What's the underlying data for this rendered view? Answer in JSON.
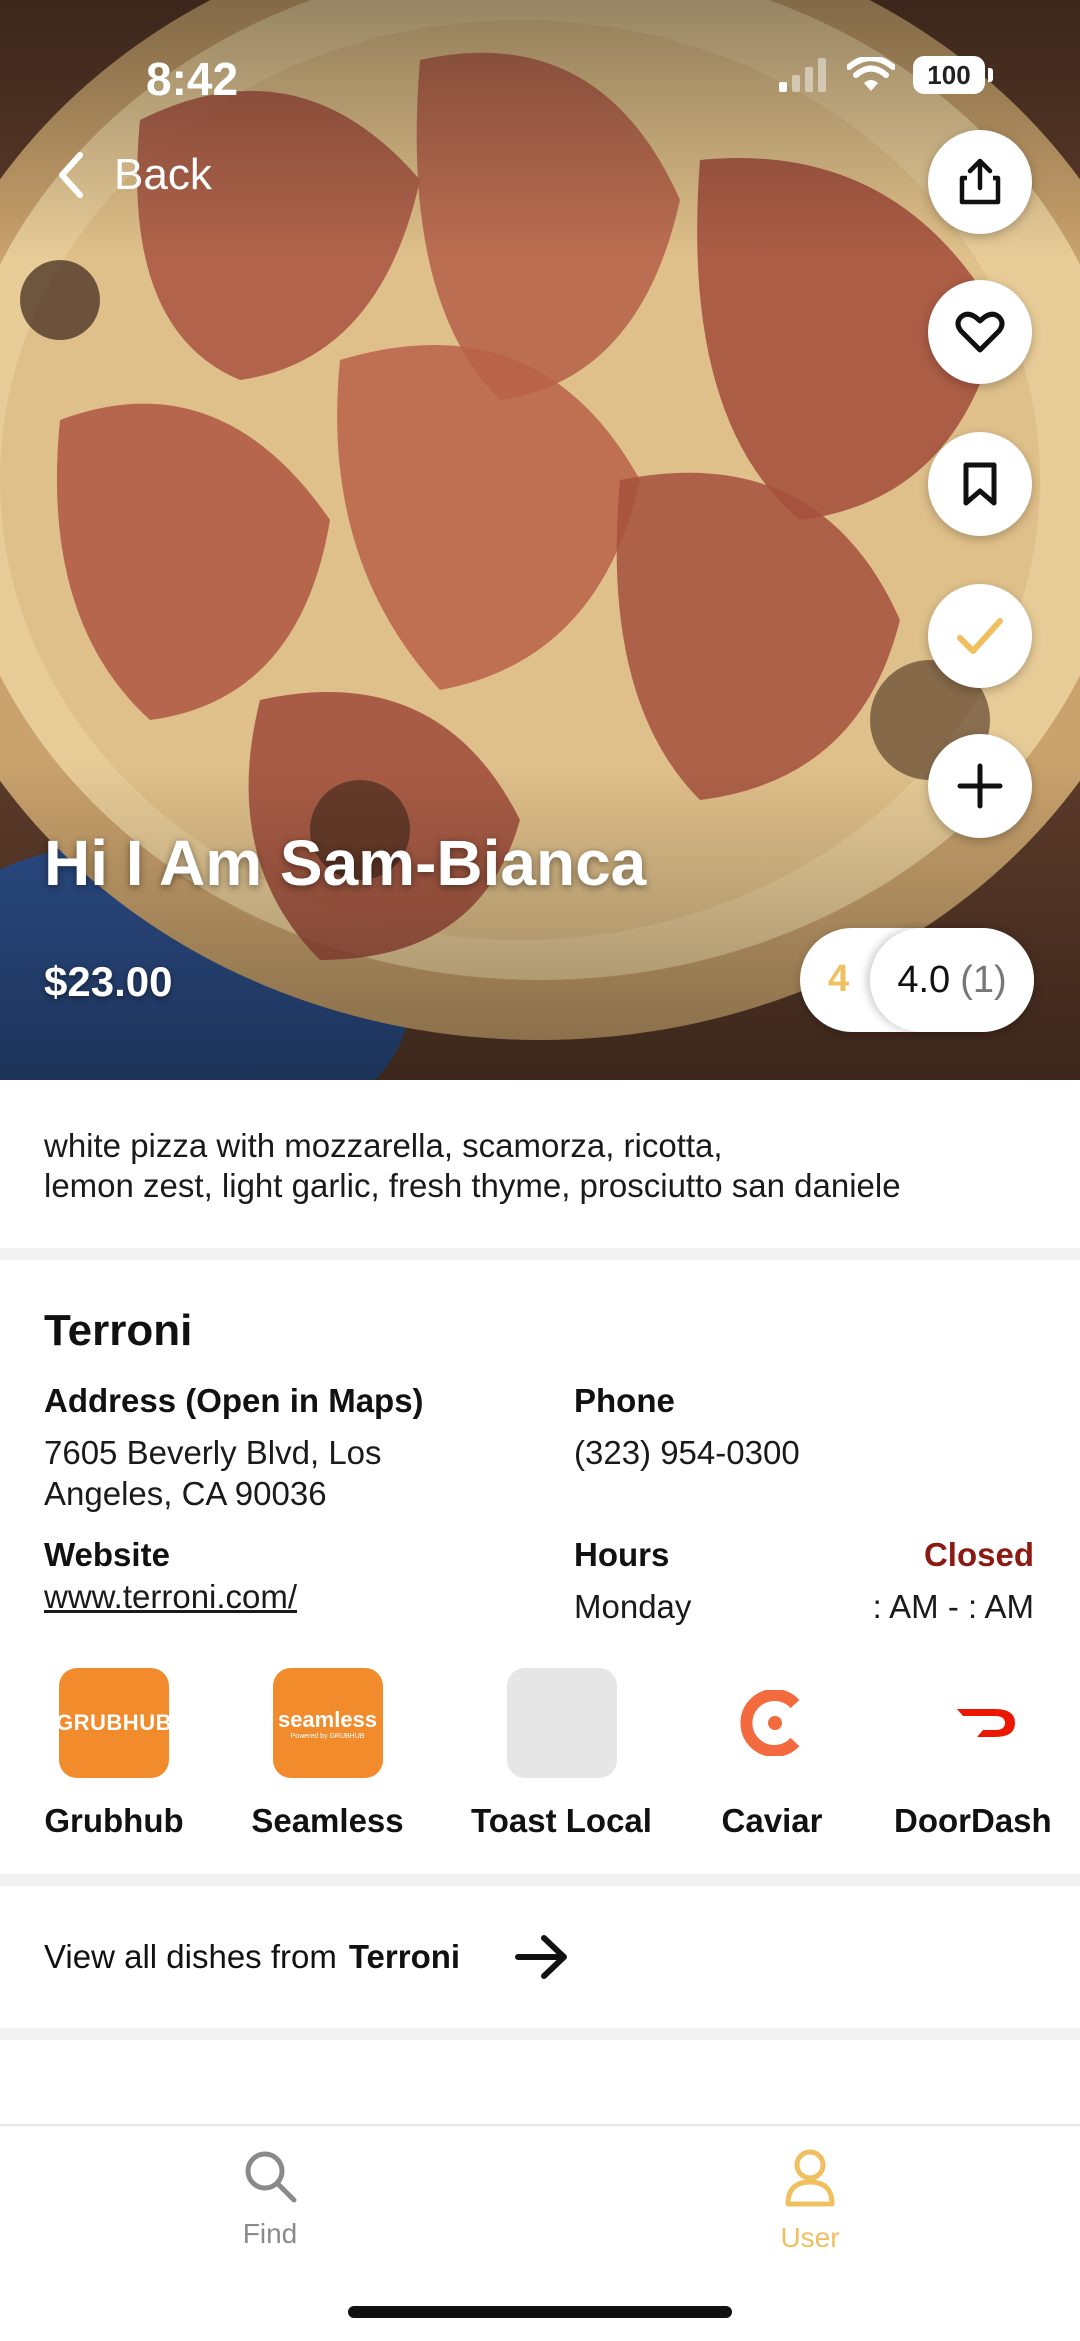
{
  "status_bar": {
    "time": "8:42",
    "battery": "100"
  },
  "nav": {
    "back_label": "Back"
  },
  "actions": [
    {
      "icon": "share-icon"
    },
    {
      "icon": "heart-icon"
    },
    {
      "icon": "bookmark-icon"
    },
    {
      "icon": "checkmark-icon"
    },
    {
      "icon": "plus-icon"
    }
  ],
  "dish": {
    "title": "Hi I Am Sam-Bianca",
    "price": "$23.00",
    "my_rating": "4",
    "average_rating": "4.0",
    "rating_count": "(1)",
    "description_line1": "white pizza with mozzarella, scamorza, ricotta,",
    "description_line2": "lemon zest, light garlic, fresh thyme, prosciutto san daniele"
  },
  "restaurant": {
    "name": "Terroni",
    "address_label": "Address (Open in Maps)",
    "address_line1": "7605 Beverly Blvd, Los",
    "address_line2": "Angeles, CA 90036",
    "phone_label": "Phone",
    "phone": "(323) 954-0300",
    "website_label": "Website",
    "website": "www.terroni.com/",
    "hours_label": "Hours",
    "status": "Closed",
    "day": "Monday",
    "hours": ": AM - : AM"
  },
  "delivery": [
    {
      "name": "Grubhub",
      "logo_text": "GRUBHUB",
      "color": "#f28b2c"
    },
    {
      "name": "Seamless",
      "logo_text": "seamless",
      "logo_subtext": "Powered by GRUBHUB",
      "color": "#f28b2c"
    },
    {
      "name": "Toast Local",
      "logo_text": "",
      "color": "#e6e6e6"
    },
    {
      "name": "Caviar",
      "logo_text": "",
      "color": "#f26a3d"
    },
    {
      "name": "DoorDash",
      "logo_text": "",
      "color": "#eb1700"
    }
  ],
  "view_all": {
    "prefix": "View all dishes from",
    "restaurant": "Terroni"
  },
  "tabs": [
    {
      "label": "Find",
      "icon": "search-icon",
      "active": false,
      "color": "#8a8a8a"
    },
    {
      "label": "User",
      "icon": "user-icon",
      "active": true,
      "color": "#f0c060"
    }
  ],
  "colors": {
    "accent": "#f0c060",
    "closed": "#8b1a12"
  }
}
